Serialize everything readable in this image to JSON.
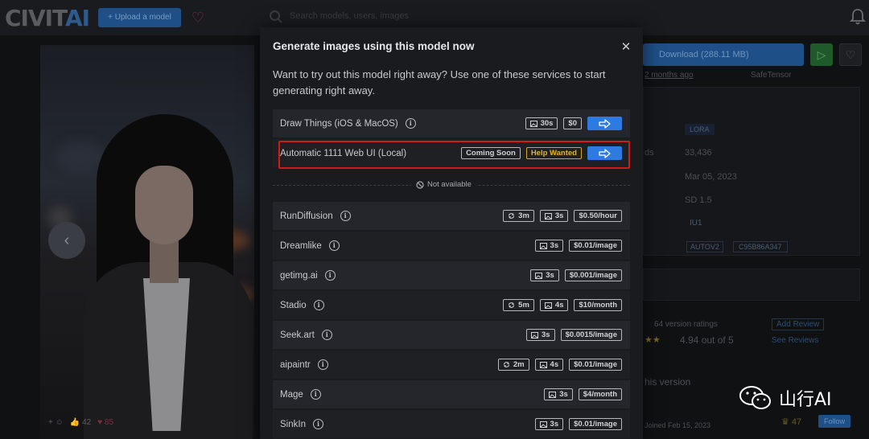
{
  "app": {
    "logo_text": "CIVIT",
    "logo_text_ai": "AI",
    "upload_label": "+ Upload a model",
    "search_placeholder": "Search models, users, images"
  },
  "hero": {
    "likes": "42",
    "hearts": "85"
  },
  "right_panel": {
    "download_label": "Download (288.11 MB)",
    "updated_text": "2 months ago",
    "safetensor_label": "SafeTensor",
    "type_tag": "LORA",
    "downloads_value": "33,436",
    "uploaded_value": "Mar 05, 2023",
    "base_model_value": "SD 1.5",
    "trigger_word": "IU1",
    "hash_type": "AUTOV2",
    "hash_value": "C95B86A347",
    "ratings_count": "64 version ratings",
    "rating_text": "4.94 out of 5",
    "add_review": "Add Review",
    "see_reviews": "See Reviews",
    "discussion_label": "his version",
    "follow_label": "Follow",
    "creator_likes": "47",
    "joined_text": "Joined Feb 15, 2023"
  },
  "modal": {
    "title": "Generate images using this model now",
    "intro": "Want to try out this model right away? Use one of these services to start generating right away.",
    "not_available_label": "Not available",
    "available_services": [
      {
        "name": "Draw Things (iOS & MacOS)",
        "badges": [
          "30s",
          "$0"
        ]
      },
      {
        "name": "Automatic 1111 Web UI (Local)",
        "badges": [
          "Coming Soon",
          "Help Wanted"
        ]
      }
    ],
    "services": [
      {
        "name": "RunDiffusion",
        "queue": "3m",
        "time": "3s",
        "price": "$0.50/hour"
      },
      {
        "name": "Dreamlike",
        "time": "3s",
        "price": "$0.01/image"
      },
      {
        "name": "getimg.ai",
        "time": "3s",
        "price": "$0.001/image"
      },
      {
        "name": "Stadio",
        "queue": "5m",
        "time": "4s",
        "price": "$10/month"
      },
      {
        "name": "Seek.art",
        "time": "3s",
        "price": "$0.0015/image"
      },
      {
        "name": "aipaintr",
        "queue": "2m",
        "time": "4s",
        "price": "$0.01/image"
      },
      {
        "name": "Mage",
        "time": "3s",
        "price": "$4/month"
      },
      {
        "name": "SinkIn",
        "time": "3s",
        "price": "$0.01/image"
      }
    ]
  },
  "watermark": {
    "text": "山行AI"
  },
  "colors": {
    "modal_bg": "#1a1b1e",
    "row_bg": "#25262b",
    "primary_blue": "#2d7be0",
    "help_yellow": "#e2b32a",
    "highlight_red": "#d11a1a"
  }
}
